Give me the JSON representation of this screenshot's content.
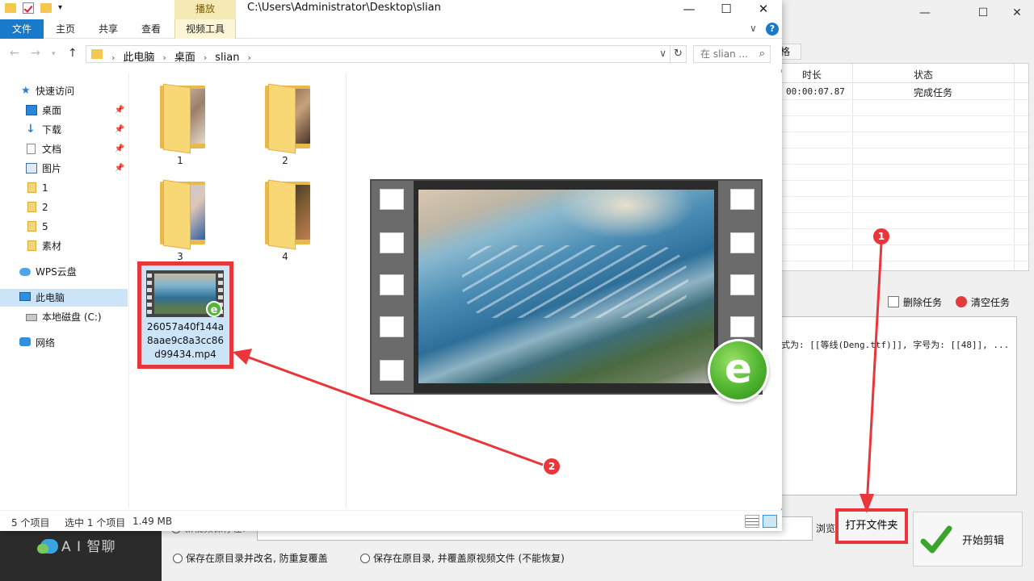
{
  "background_app": {
    "table_headers": [
      "时长",
      "状态"
    ],
    "row1": {
      "duration": "00:00:07.87",
      "status": "完成任务"
    },
    "tab_fragment": "格",
    "actions": {
      "delete_task": "删除任务",
      "clear_tasks": "清空任务"
    },
    "log_text": "式为: [[等线(Deng.ttf)]], 字号为: [[48]], ...",
    "save_label_partial": "新视频保存在:",
    "browse": "浏览",
    "open_folder": "打开文件夹",
    "start_edit": "开始剪辑",
    "radio_1": "保存在原目录并改名, 防重复覆盖",
    "radio_2": "保存在原目录, 并覆盖原视频文件 (不能恢复)",
    "brand": "A I 智聊"
  },
  "explorer": {
    "title_path": "C:\\Users\\Administrator\\Desktop\\slian",
    "context_tab": "播放",
    "ribbon_tabs": [
      "文件",
      "主页",
      "共享",
      "查看",
      "视频工具"
    ],
    "breadcrumb": [
      "此电脑",
      "桌面",
      "slian"
    ],
    "search_placeholder": "在 slian ...",
    "nav": {
      "quick_access": "快速访问",
      "desktop": "桌面",
      "downloads": "下载",
      "documents": "文档",
      "pictures": "图片",
      "f1": "1",
      "f2": "2",
      "f5": "5",
      "material": "素材",
      "wps": "WPS云盘",
      "this_pc": "此电脑",
      "local_disk": "本地磁盘 (C:)",
      "network": "网络"
    },
    "folders": [
      "1",
      "2",
      "3",
      "4"
    ],
    "selected_file": "26057a40f144a8aae9c8a3cc86d99434.mp4",
    "status": {
      "count": "5 个项目",
      "selected": "选中 1 个项目",
      "size": "1.49 MB"
    }
  },
  "annotations": {
    "badge1": "1",
    "badge2": "2"
  },
  "colors": {
    "accent": "#1979ca",
    "annotation_red": "#e8363b",
    "selection": "#cce4f7"
  }
}
